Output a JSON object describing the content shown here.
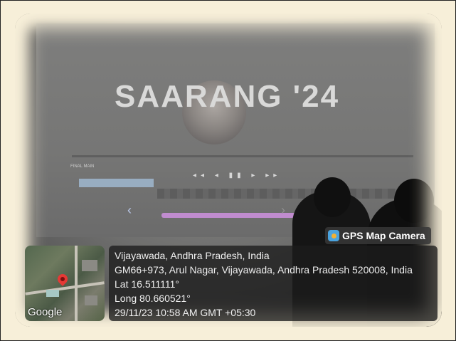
{
  "screen": {
    "title": "SAARANG '24",
    "track_label": "FINAL MAIN",
    "transport_icons": "◂◂ ◂ ▮▮ ▸ ▸▸",
    "slider_left_chevron": "‹",
    "slider_right_chevron": "›"
  },
  "badge": {
    "label": "GPS Map Camera",
    "icon": "map-pin-icon"
  },
  "location": {
    "city": "Vijayawada, Andhra Pradesh, India",
    "address": "GM66+973, Arul Nagar, Vijayawada, Andhra Pradesh 520008, India",
    "lat": "Lat 16.511111°",
    "long": "Long 80.660521°",
    "datetime": "29/11/23 10:58 AM GMT +05:30"
  },
  "map": {
    "attribution": "Google"
  },
  "colors": {
    "background": "#f7efd9",
    "panel": "#1c1c1c",
    "marker": "#e53935",
    "slider": "#c08ccf"
  }
}
